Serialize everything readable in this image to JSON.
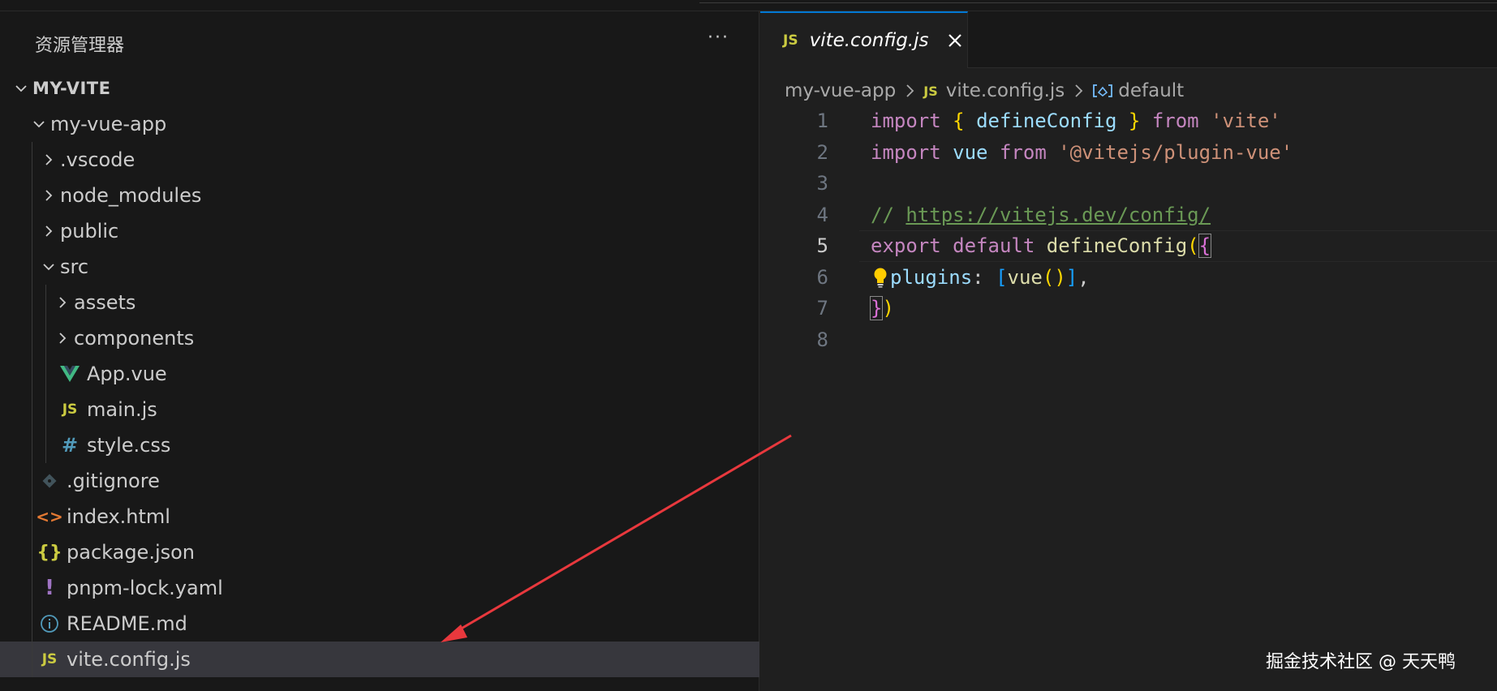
{
  "explorer": {
    "title": "资源管理器",
    "more": "···",
    "rows": [
      {
        "label": "MY-VITE",
        "depth": 0,
        "kind": "root",
        "expanded": true
      },
      {
        "label": "my-vue-app",
        "depth": 1,
        "kind": "folder",
        "expanded": true
      },
      {
        "label": ".vscode",
        "depth": 2,
        "kind": "folder",
        "expanded": false
      },
      {
        "label": "node_modules",
        "depth": 2,
        "kind": "folder",
        "expanded": false
      },
      {
        "label": "public",
        "depth": 2,
        "kind": "folder",
        "expanded": false
      },
      {
        "label": "src",
        "depth": 2,
        "kind": "folder",
        "expanded": true
      },
      {
        "label": "assets",
        "depth": 3,
        "kind": "folder",
        "expanded": false
      },
      {
        "label": "components",
        "depth": 3,
        "kind": "folder",
        "expanded": false
      },
      {
        "label": "App.vue",
        "depth": 3,
        "kind": "file",
        "icon": "vue-icon"
      },
      {
        "label": "main.js",
        "depth": 3,
        "kind": "file",
        "icon": "js-icon",
        "icon_text": "JS"
      },
      {
        "label": "style.css",
        "depth": 3,
        "kind": "file",
        "icon": "css-icon",
        "icon_text": "#"
      },
      {
        "label": ".gitignore",
        "depth": 2,
        "kind": "file",
        "icon": "git-icon"
      },
      {
        "label": "index.html",
        "depth": 2,
        "kind": "file",
        "icon": "html-icon",
        "icon_text": "<>"
      },
      {
        "label": "package.json",
        "depth": 2,
        "kind": "file",
        "icon": "json-icon",
        "icon_text": "{}"
      },
      {
        "label": "pnpm-lock.yaml",
        "depth": 2,
        "kind": "file",
        "icon": "yaml-icon",
        "icon_text": "!"
      },
      {
        "label": "README.md",
        "depth": 2,
        "kind": "file",
        "icon": "info-icon"
      },
      {
        "label": "vite.config.js",
        "depth": 2,
        "kind": "file",
        "icon": "js-icon",
        "icon_text": "JS",
        "selected": true
      }
    ]
  },
  "tab": {
    "icon_text": "JS",
    "label": "vite.config.js",
    "close_icon": "close-icon"
  },
  "breadcrumb": {
    "folder": "my-vue-app",
    "file_icon_text": "JS",
    "file": "vite.config.js",
    "symbol": "default"
  },
  "code": {
    "current_line": 5,
    "lines": [
      {
        "n": "1",
        "tokens": [
          [
            "import",
            "kw"
          ],
          [
            " ",
            ""
          ],
          [
            "{",
            "br1"
          ],
          [
            " ",
            ""
          ],
          [
            "defineConfig",
            "var"
          ],
          [
            " ",
            ""
          ],
          [
            "}",
            "br1"
          ],
          [
            " ",
            ""
          ],
          [
            "from",
            "kw"
          ],
          [
            " ",
            ""
          ],
          [
            "'vite'",
            "str"
          ]
        ]
      },
      {
        "n": "2",
        "tokens": [
          [
            "import",
            "kw"
          ],
          [
            " ",
            ""
          ],
          [
            "vue",
            "var"
          ],
          [
            " ",
            ""
          ],
          [
            "from",
            "kw"
          ],
          [
            " ",
            ""
          ],
          [
            "'@vitejs/plugin-vue'",
            "str"
          ]
        ]
      },
      {
        "n": "3",
        "tokens": []
      },
      {
        "n": "4",
        "tokens": [
          [
            "// ",
            "cmt"
          ],
          [
            "https://vitejs.dev/config/",
            "cmt-link"
          ]
        ]
      },
      {
        "n": "5",
        "tokens": [
          [
            "export",
            "kw"
          ],
          [
            " ",
            ""
          ],
          [
            "default",
            "kw"
          ],
          [
            " ",
            ""
          ],
          [
            "defineConfig",
            "fn"
          ],
          [
            "(",
            "br1"
          ],
          [
            "{",
            "br2 boxed"
          ]
        ]
      },
      {
        "n": "6",
        "tokens": [
          [
            "BULB",
            "bulb"
          ],
          [
            "plugins",
            "var"
          ],
          [
            ": ",
            "punc"
          ],
          [
            "[",
            "br3"
          ],
          [
            "vue",
            "fn"
          ],
          [
            "()",
            "br1"
          ],
          [
            "]",
            "br3"
          ],
          [
            ",",
            "punc"
          ]
        ]
      },
      {
        "n": "7",
        "tokens": [
          [
            "}",
            "br2 boxed"
          ],
          [
            ")",
            "br1"
          ]
        ]
      },
      {
        "n": "8",
        "tokens": []
      }
    ]
  },
  "watermark": "掘金技术社区 @ 天天鸭",
  "colors": {
    "accent": "#0078d4",
    "annotation_arrow": "#e8383d",
    "js_icon": "#cbcb41",
    "vue_icon": "#41b883"
  }
}
